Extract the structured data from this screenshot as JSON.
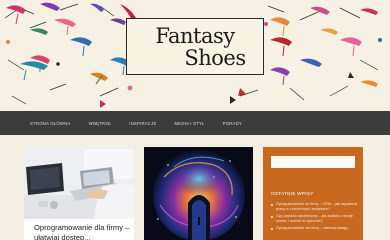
{
  "site": {
    "title_line1": "Fantasy",
    "title_line2": "Shoes"
  },
  "nav": {
    "items": [
      "Strona główna",
      "Wnętrze",
      "Inspiracje",
      "Media i styl",
      "Porady"
    ]
  },
  "posts": [
    {
      "title": "Oprogramowanie dla firmy – ułatwiaj dostęp..."
    },
    {
      "title": ""
    }
  ],
  "sidebar": {
    "search_placeholder": "",
    "heading": "Ostatnie wpisy",
    "recent": [
      "Oprogramowanie do firmy – CRM – jak usprawnić pracę w codziennych zadaniach?",
      "Czy uzyskać szkoleniowy – jak zadbać o swoje cenne, i dobrze to wykonać?",
      "Oprogramowanie dla firmy – ułatwiaj dostęp..."
    ]
  },
  "colors": {
    "nav_bg": "#3c3c3c",
    "sidebar_bg": "#c8691f",
    "page_bg": "#f4efe3"
  }
}
